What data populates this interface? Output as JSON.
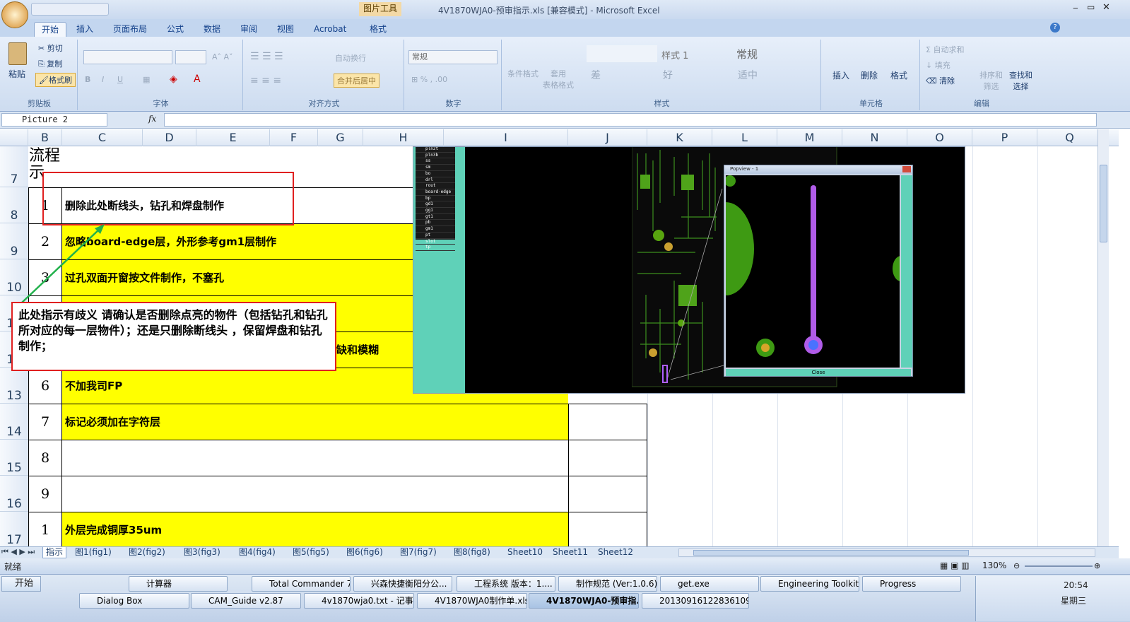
{
  "window": {
    "title": "4V1870WJA0-预审指示.xls  [兼容模式] - Microsoft Excel",
    "context_tool": "图片工具"
  },
  "tabs": [
    "开始",
    "插入",
    "页面布局",
    "公式",
    "数据",
    "审阅",
    "视图",
    "Acrobat",
    "格式"
  ],
  "ribbon": {
    "clipboard": {
      "label": "剪贴板",
      "paste": "粘贴",
      "cut": "剪切",
      "copy": "复制",
      "format_painter": "格式刷"
    },
    "font": {
      "label": "字体"
    },
    "alignment": {
      "label": "对齐方式",
      "wrap": "自动换行",
      "merge": "合并后居中"
    },
    "number": {
      "label": "数字",
      "format": "常规"
    },
    "styles": {
      "label": "样式",
      "conditional": "条件格式",
      "table": "套用\n表格格式",
      "style1": "样式 1",
      "normal": "常规",
      "bad": "差",
      "good": "好",
      "neutral": "适中"
    },
    "cells": {
      "label": "单元格",
      "insert": "插入",
      "delete": "删除",
      "format": "格式"
    },
    "editing": {
      "label": "编辑",
      "autosum": "自动求和",
      "fill": "填充",
      "clear": "清除",
      "sort": "排序和\n筛选",
      "find": "查找和\n选择"
    }
  },
  "formula_bar": {
    "name_box": "Picture 2",
    "fx": "fx"
  },
  "columns": [
    "B",
    "C",
    "D",
    "E",
    "F",
    "G",
    "H",
    "I",
    "J",
    "K",
    "L",
    "M",
    "N",
    "O",
    "P",
    "Q"
  ],
  "rows": [
    {
      "num": "7",
      "seq": "",
      "text": "流程\n示"
    },
    {
      "num": "8",
      "seq": "1",
      "text": "删除此处断线头，钻孔和焊盘制作"
    },
    {
      "num": "9",
      "seq": "2",
      "text": "忽略board-edge层，外形参考gm1层制作"
    },
    {
      "num": "10",
      "seq": "3",
      "text": "过孔双面开窗按文件制作，不塞孔"
    },
    {
      "num": "11",
      "seq": "",
      "text": ""
    },
    {
      "num": "12",
      "seq": "",
      "text": "缺和模糊"
    },
    {
      "num": "13",
      "seq": "6",
      "text": "不加我司FP"
    },
    {
      "num": "14",
      "seq": "7",
      "text": "标记必须加在字符层"
    },
    {
      "num": "15",
      "seq": "8",
      "text": ""
    },
    {
      "num": "16",
      "seq": "9",
      "text": ""
    },
    {
      "num": "17",
      "seq": "1",
      "text": "外层完成铜厚35um"
    }
  ],
  "callout": {
    "text": "此处指示有歧义 请确认是否删除点亮的物件（包括钻孔和钻孔所对应的每一层物件）；还是只删除断线头 ，保留焊盘和钻孔制作；"
  },
  "popview": {
    "title": "Popview - 1",
    "close": "Close"
  },
  "layers": [
    "pln2t",
    "pln3b",
    "ss",
    "sm",
    "bo",
    "drl",
    "rout",
    "board-edge",
    "bp",
    "gd1",
    "gg1",
    "gt1",
    "pb",
    "gm1",
    "pt",
    "slot",
    "tp"
  ],
  "sheets": [
    "指示",
    "图1(fig1)",
    "图2(fig2)",
    "图3(fig3)",
    "图4(fig4)",
    "图5(fig5)",
    "图6(fig6)",
    "图7(fig7)",
    "图8(fig8)",
    "Sheet10",
    "Sheet11",
    "Sheet12"
  ],
  "status": {
    "ready": "就绪",
    "zoom": "130%"
  },
  "taskbar": {
    "start": "开始",
    "row1": [
      "计算器",
      "Total Commander 7.0...",
      "兴森快捷衡阳分公...",
      "工程系统  版本：1....",
      "制作规范 (Ver:1.0.6)",
      "get.exe",
      "Engineering Toolkit 9....",
      "Progress"
    ],
    "row2": [
      "Dialog Box",
      "CAM_Guide v2.87",
      "4v1870wja0.txt - 记事本",
      "4V1870WJA0制作单.xls ...",
      "4V1870WJA0-预审指...",
      "20130916122836109.rtf..."
    ],
    "clock": "20:54",
    "weekday": "星期三"
  },
  "colors": {
    "highlight": "#ffff00",
    "callout_border": "#e02020",
    "arrow": "#22b14c"
  }
}
